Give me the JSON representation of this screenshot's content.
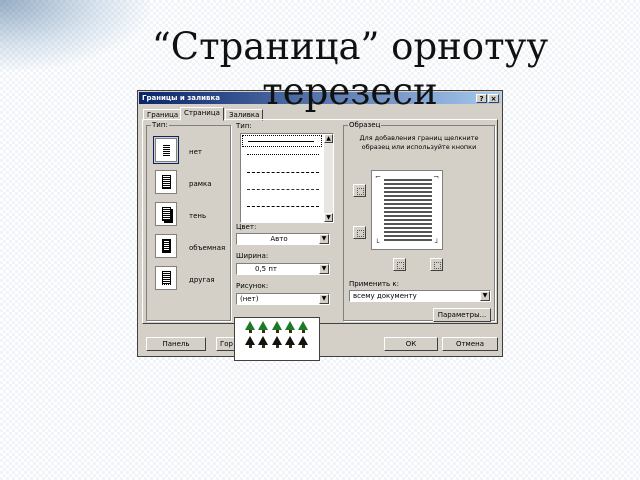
{
  "slide": {
    "title_line1": "“Страница” орнотуу",
    "title_line2": "терезеси"
  },
  "dialog": {
    "title": "Границы и заливка",
    "help_button": "?",
    "close_button": "×",
    "tabs": [
      "Граница",
      "Страница",
      "Заливка"
    ],
    "type_label": "Тип:",
    "types": [
      "нет",
      "рамка",
      "тень",
      "объемная",
      "другая"
    ],
    "line_style_label": "Тип:",
    "color_label": "Цвет:",
    "color_value": "Авто",
    "width_label": "Ширина:",
    "width_value": "0,5 пт",
    "art_label": "Рисунок:",
    "art_value": "(нет)",
    "preview_label": "Образец",
    "preview_hint": "Для добавления границ щелкните образец или используйте кнопки",
    "apply_label": "Применить к:",
    "apply_value": "всему документу",
    "options_button": "Параметры...",
    "print_button": "Панель",
    "toolbar_button": "Гор",
    "ok_button": "ОК",
    "cancel_button": "Отмена"
  },
  "colors": {
    "titlebar_start": "#0a246a",
    "titlebar_end": "#a6caf0",
    "face": "#d4d0c8",
    "tree_green": "#1a7a25"
  },
  "icons": [
    "help-icon",
    "close-icon",
    "border-type-icon",
    "tree-art-icon",
    "dropdown-arrow-icon"
  ]
}
